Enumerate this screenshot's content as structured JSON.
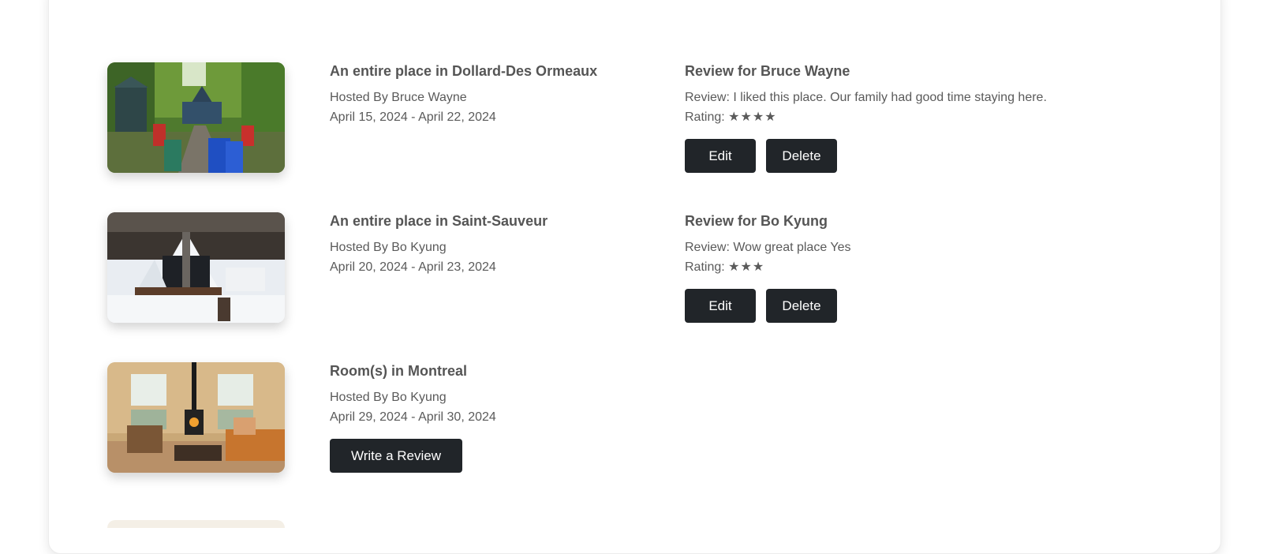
{
  "bookings": [
    {
      "title": "An entire place in Dollard-Des Ormeaux",
      "hosted": "Hosted By Bruce Wayne",
      "dates": "April 15, 2024 - April 22, 2024",
      "image_alt": "cabin-in-woods-photo",
      "review": {
        "heading": "Review for Bruce Wayne",
        "text": "Review: I liked this place. Our family had good time staying here.",
        "rating_label": "Rating:",
        "rating_stars": "★★★★",
        "rating_value": 4,
        "edit_label": "Edit",
        "delete_label": "Delete"
      }
    },
    {
      "title": "An entire place in Saint-Sauveur",
      "hosted": "Hosted By Bo Kyung",
      "dates": "April 20, 2024 - April 23, 2024",
      "image_alt": "snowy-chalet-photo",
      "review": {
        "heading": "Review for Bo Kyung",
        "text": "Review: Wow great place Yes",
        "rating_label": "Rating:",
        "rating_stars": "★★★",
        "rating_value": 3,
        "edit_label": "Edit",
        "delete_label": "Delete"
      }
    },
    {
      "title": "Room(s) in Montreal",
      "hosted": "Hosted By Bo Kyung",
      "dates": "April 29, 2024 - April 30, 2024",
      "image_alt": "living-room-photo",
      "write_review_label": "Write a Review"
    }
  ],
  "colors": {
    "button_bg": "#212529",
    "button_text": "#ffffff",
    "title_text": "#555555"
  }
}
